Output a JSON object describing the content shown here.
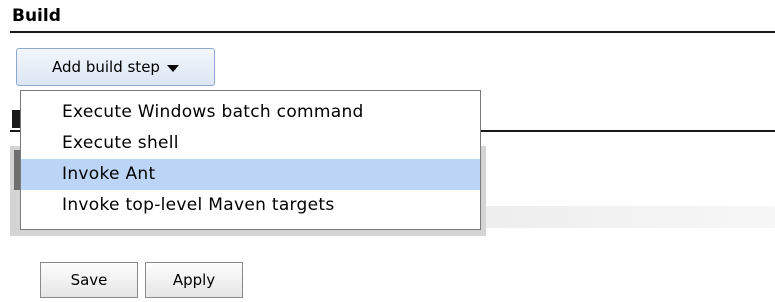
{
  "section": {
    "title": "Build"
  },
  "add_step": {
    "label": "Add build step"
  },
  "menu": {
    "items": [
      {
        "label": "Execute Windows batch command"
      },
      {
        "label": "Execute shell"
      },
      {
        "label": "Invoke Ant"
      },
      {
        "label": "Invoke top-level Maven targets"
      }
    ],
    "highlighted_index": 2
  },
  "actions": {
    "save_label": "Save",
    "apply_label": "Apply"
  },
  "colors": {
    "menu_highlight": "#bcd4f6",
    "button_border": "#8ea9cf"
  }
}
